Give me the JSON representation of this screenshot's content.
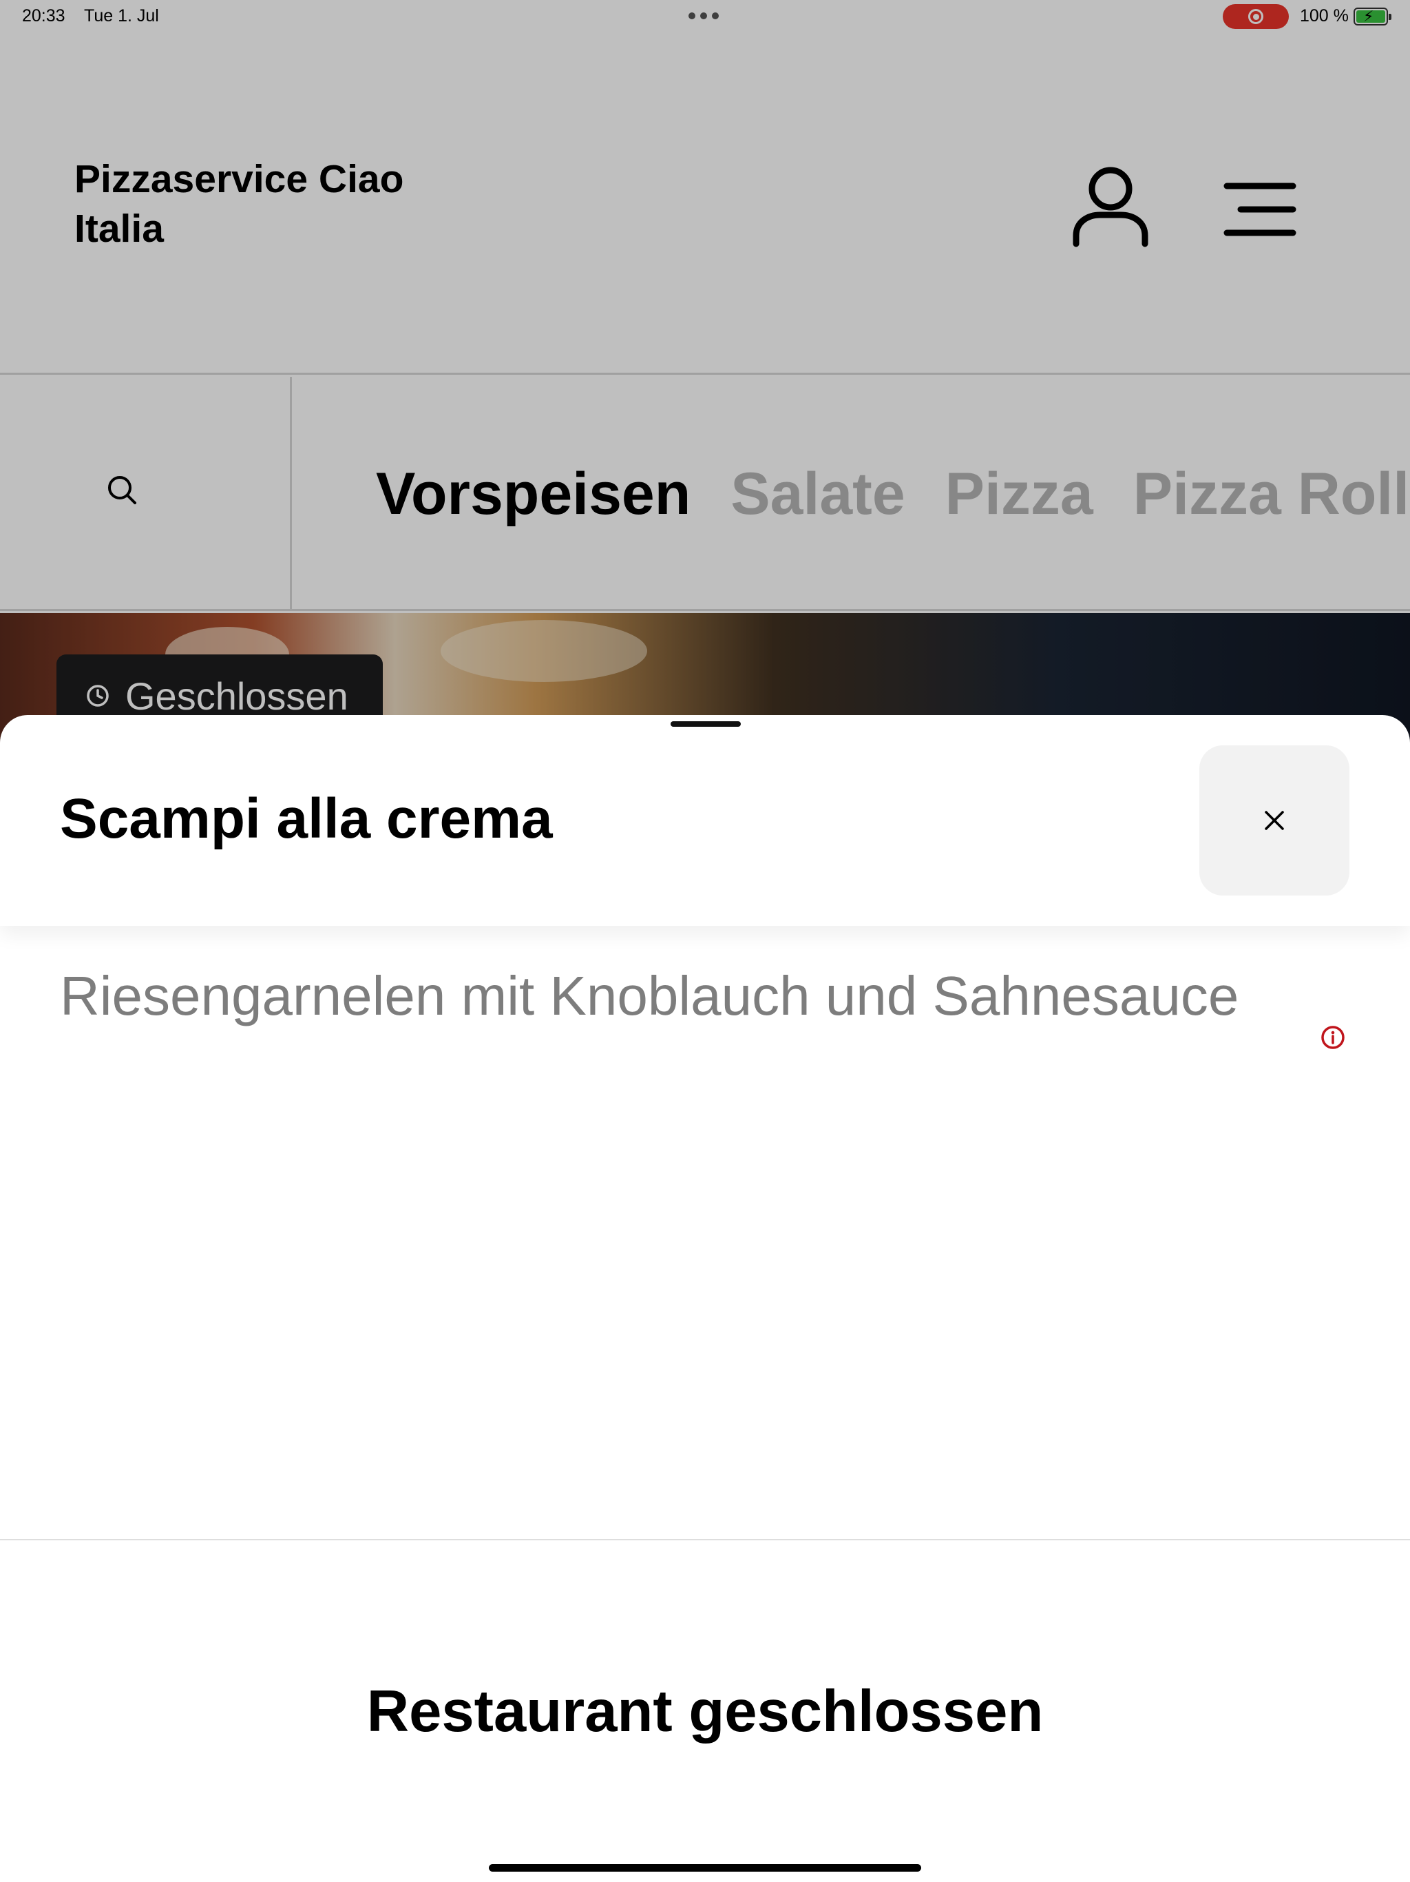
{
  "status_bar": {
    "time": "20:33",
    "date": "Tue 1. Jul",
    "battery": "100 %",
    "recording_color": "#e8332a"
  },
  "header": {
    "brand": "Pizzaservice Ciao Italia",
    "user_icon": "user-icon",
    "menu_icon": "hamburger-menu-icon"
  },
  "categories": {
    "search_icon": "search-icon",
    "tabs": [
      "Vorspeisen",
      "Salate",
      "Pizza",
      "Pizza Rollo"
    ],
    "active_index": 0
  },
  "hero": {
    "status_chip": "Geschlossen",
    "clock_icon": "clock-icon"
  },
  "sheet": {
    "title": "Scampi alla crema",
    "close_icon": "close-icon",
    "description": "Riesengarnelen mit Knoblauch und Sahnesauce",
    "info_icon": "info-icon",
    "info_color": "#c0151c",
    "footer_status": "Restaurant geschlossen"
  }
}
